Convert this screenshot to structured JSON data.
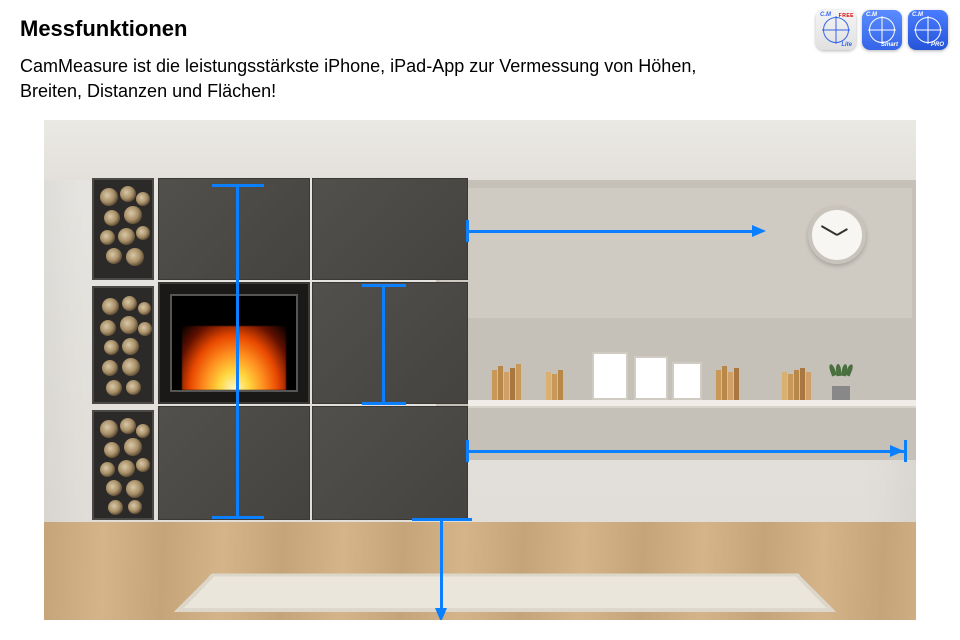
{
  "header": {
    "title": "Messfunktionen",
    "subtitle": "CamMeasure ist die leistungsstärkste iPhone, iPad-App zur Vermessung von Höhen, Breiten, Distanzen und Flächen!"
  },
  "app_icons": [
    {
      "brand": "C.M",
      "variant": "Lite",
      "free_badge": "FREE"
    },
    {
      "brand": "C.M",
      "variant": "Smart"
    },
    {
      "brand": "C.M",
      "variant": "PRO"
    }
  ],
  "measurements": {
    "arrow_color": "#0a7fff",
    "overlays": [
      {
        "type": "vertical-span",
        "desc": "fireplace full height"
      },
      {
        "type": "vertical-span",
        "desc": "right tile height"
      },
      {
        "type": "horizontal-span",
        "desc": "shelf section width"
      },
      {
        "type": "horizontal-span",
        "desc": "lower wall full width"
      },
      {
        "type": "distance-arrow",
        "desc": "distance to floor point"
      }
    ]
  }
}
